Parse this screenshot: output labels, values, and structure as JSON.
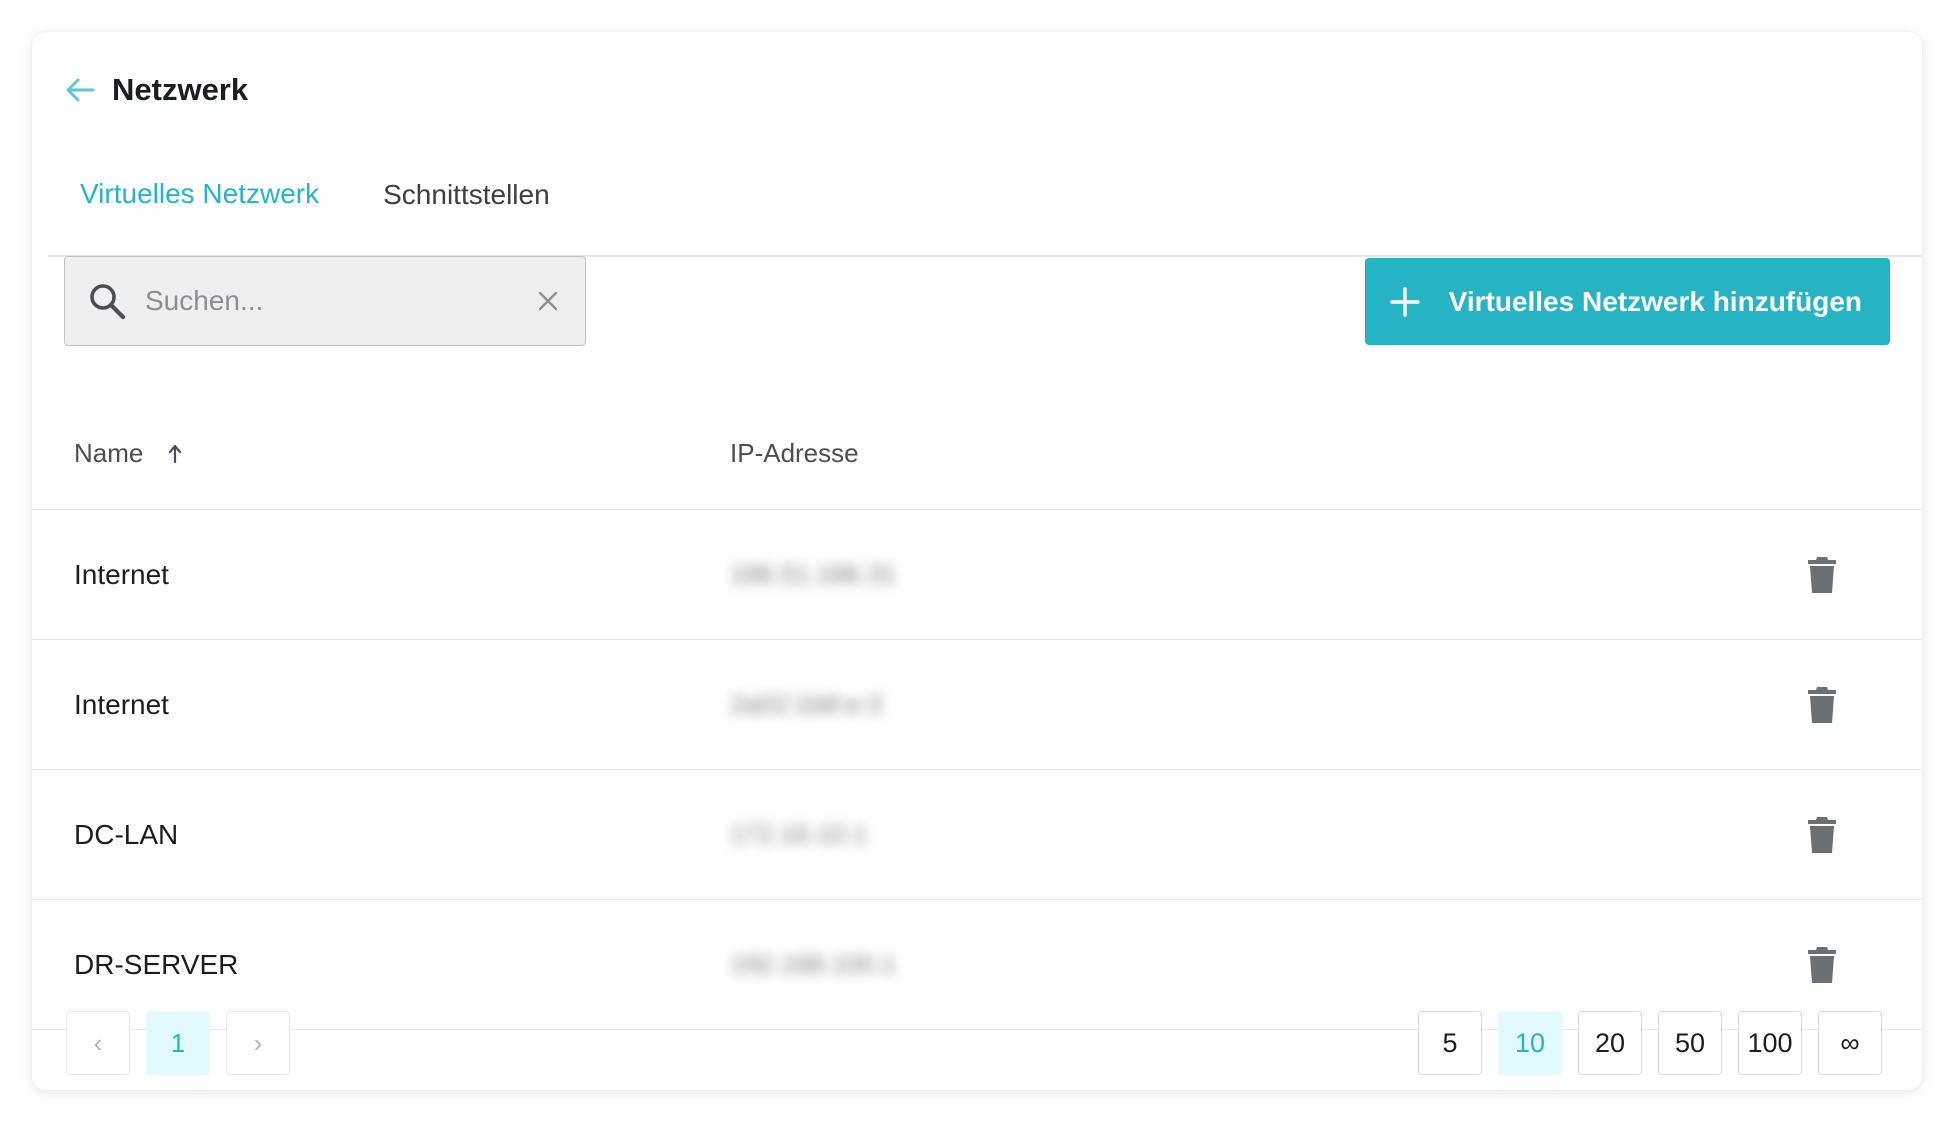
{
  "header": {
    "title": "Netzwerk"
  },
  "tabs": [
    {
      "label": "Virtuelles Netzwerk",
      "active": true
    },
    {
      "label": "Schnittstellen",
      "active": false
    }
  ],
  "search": {
    "placeholder": "Suchen...",
    "value": ""
  },
  "toolbar": {
    "add_label": "Virtuelles Netzwerk hinzufügen"
  },
  "table": {
    "columns": {
      "name": "Name",
      "ip": "IP-Adresse"
    },
    "sort": {
      "column": "name",
      "direction": "ascending"
    },
    "rows": [
      {
        "name": "Internet",
        "ip": "186.51.186.31"
      },
      {
        "name": "Internet",
        "ip": "2a02:1b8:e:3"
      },
      {
        "name": "DC-LAN",
        "ip": "172.16.10.1"
      },
      {
        "name": "DR-SERVER",
        "ip": "192.168.100.1"
      }
    ]
  },
  "pagination": {
    "prev_label": "‹",
    "next_label": "›",
    "current_page": "1",
    "page_sizes": [
      "5",
      "10",
      "20",
      "50",
      "100",
      "∞"
    ],
    "selected_page_size": "10"
  },
  "colors": {
    "accent": "#26b4c5",
    "accent_light": "#e2fafd",
    "icon_gray": "#6b7075"
  }
}
